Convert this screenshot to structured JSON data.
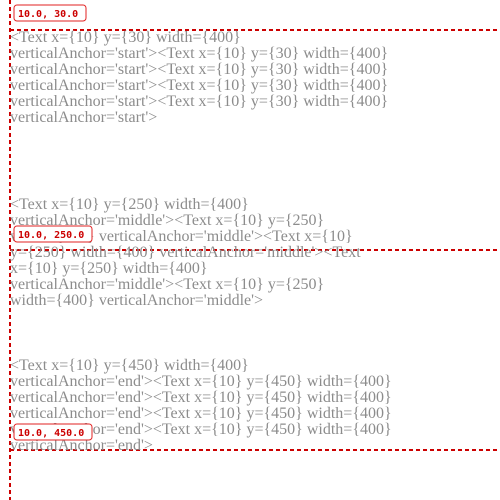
{
  "colors": {
    "guide": "#cc0000",
    "text": "#8c8c8c",
    "badge_border": "#e22222",
    "background": "#ffffff"
  },
  "blocks": [
    {
      "anchor": "start",
      "badge": "10.0, 30.0",
      "lines": [
        "<Text x={10} y={30} width={400}",
        "verticalAnchor='start'><Text x={10} y={30} width={400}",
        "verticalAnchor='start'><Text x={10} y={30} width={400}",
        "verticalAnchor='start'><Text x={10} y={30} width={400}",
        "verticalAnchor='start'><Text x={10} y={30} width={400}",
        "verticalAnchor='start'>"
      ]
    },
    {
      "anchor": "middle",
      "badge": "10.0, 250.0",
      "lines": [
        "<Text x={10} y={250} width={400}",
        "verticalAnchor='middle'><Text x={10} y={250}",
        "width={400} verticalAnchor='middle'><Text x={10}",
        "y={250} width={400} verticalAnchor='middle'><Text",
        "x={10} y={250} width={400}",
        "verticalAnchor='middle'><Text x={10} y={250}",
        "width={400} verticalAnchor='middle'>"
      ]
    },
    {
      "anchor": "end",
      "badge": "10.0, 450.0",
      "lines": [
        "<Text x={10} y={450} width={400}",
        "verticalAnchor='end'><Text x={10} y={450} width={400}",
        "verticalAnchor='end'><Text x={10} y={450} width={400}",
        "verticalAnchor='end'><Text x={10} y={450} width={400}",
        "verticalAnchor='end'><Text x={10} y={450} width={400}",
        "verticalAnchor='end'>"
      ]
    }
  ]
}
